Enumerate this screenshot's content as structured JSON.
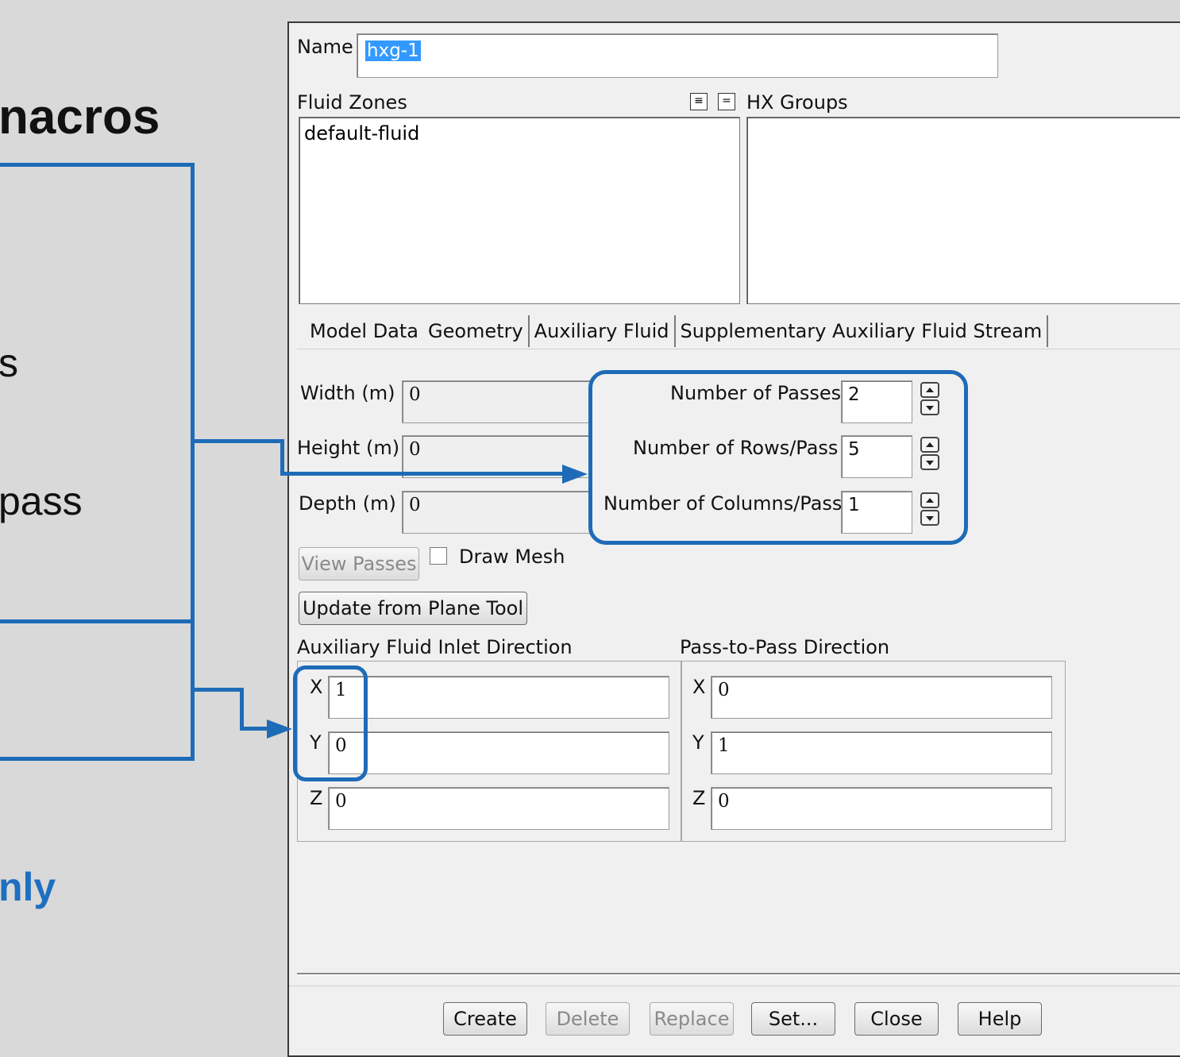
{
  "slide": {
    "title_fragment": "nacros",
    "line1_fragment": "s",
    "line2_fragment": "pass",
    "line3_fragment": "nly"
  },
  "dialog": {
    "name_label": "Name",
    "name_value": "hxg-1",
    "fluid_zones_label": "Fluid Zones",
    "fluid_zones_items": [
      "default-fluid"
    ],
    "hx_groups_label": "HX Groups",
    "tabs": [
      "Model Data",
      "Geometry",
      "Auxiliary Fluid",
      "Supplementary Auxiliary Fluid Stream"
    ],
    "active_tab": "Geometry",
    "width_label": "Width (m)",
    "width_value": "0",
    "height_label": "Height (m)",
    "height_value": "0",
    "depth_label": "Depth (m)",
    "depth_value": "0",
    "passes_label": "Number of Passes",
    "passes_value": "2",
    "rows_label": "Number of Rows/Pass",
    "rows_value": "5",
    "columns_label": "Number of Columns/Pass",
    "columns_value": "1",
    "view_passes_label": "View Passes",
    "draw_mesh_label": "Draw Mesh",
    "update_label": "Update from Plane Tool",
    "aux_dir_label": "Auxiliary Fluid Inlet Direction",
    "aux_x_label": "X",
    "aux_x_value": "1",
    "aux_y_label": "Y",
    "aux_y_value": "0",
    "aux_z_label": "Z",
    "aux_z_value": "0",
    "pass_dir_label": "Pass-to-Pass Direction",
    "pass_x_label": "X",
    "pass_x_value": "0",
    "pass_y_label": "Y",
    "pass_y_value": "1",
    "pass_z_label": "Z",
    "pass_z_value": "0",
    "buttons": {
      "create": "Create",
      "delete": "Delete",
      "replace": "Replace",
      "set": "Set...",
      "close": "Close",
      "help": "Help"
    }
  },
  "colors": {
    "accent": "#1e6bb8",
    "selection": "#3399ff",
    "dialog_bg": "#f0f0f0"
  }
}
